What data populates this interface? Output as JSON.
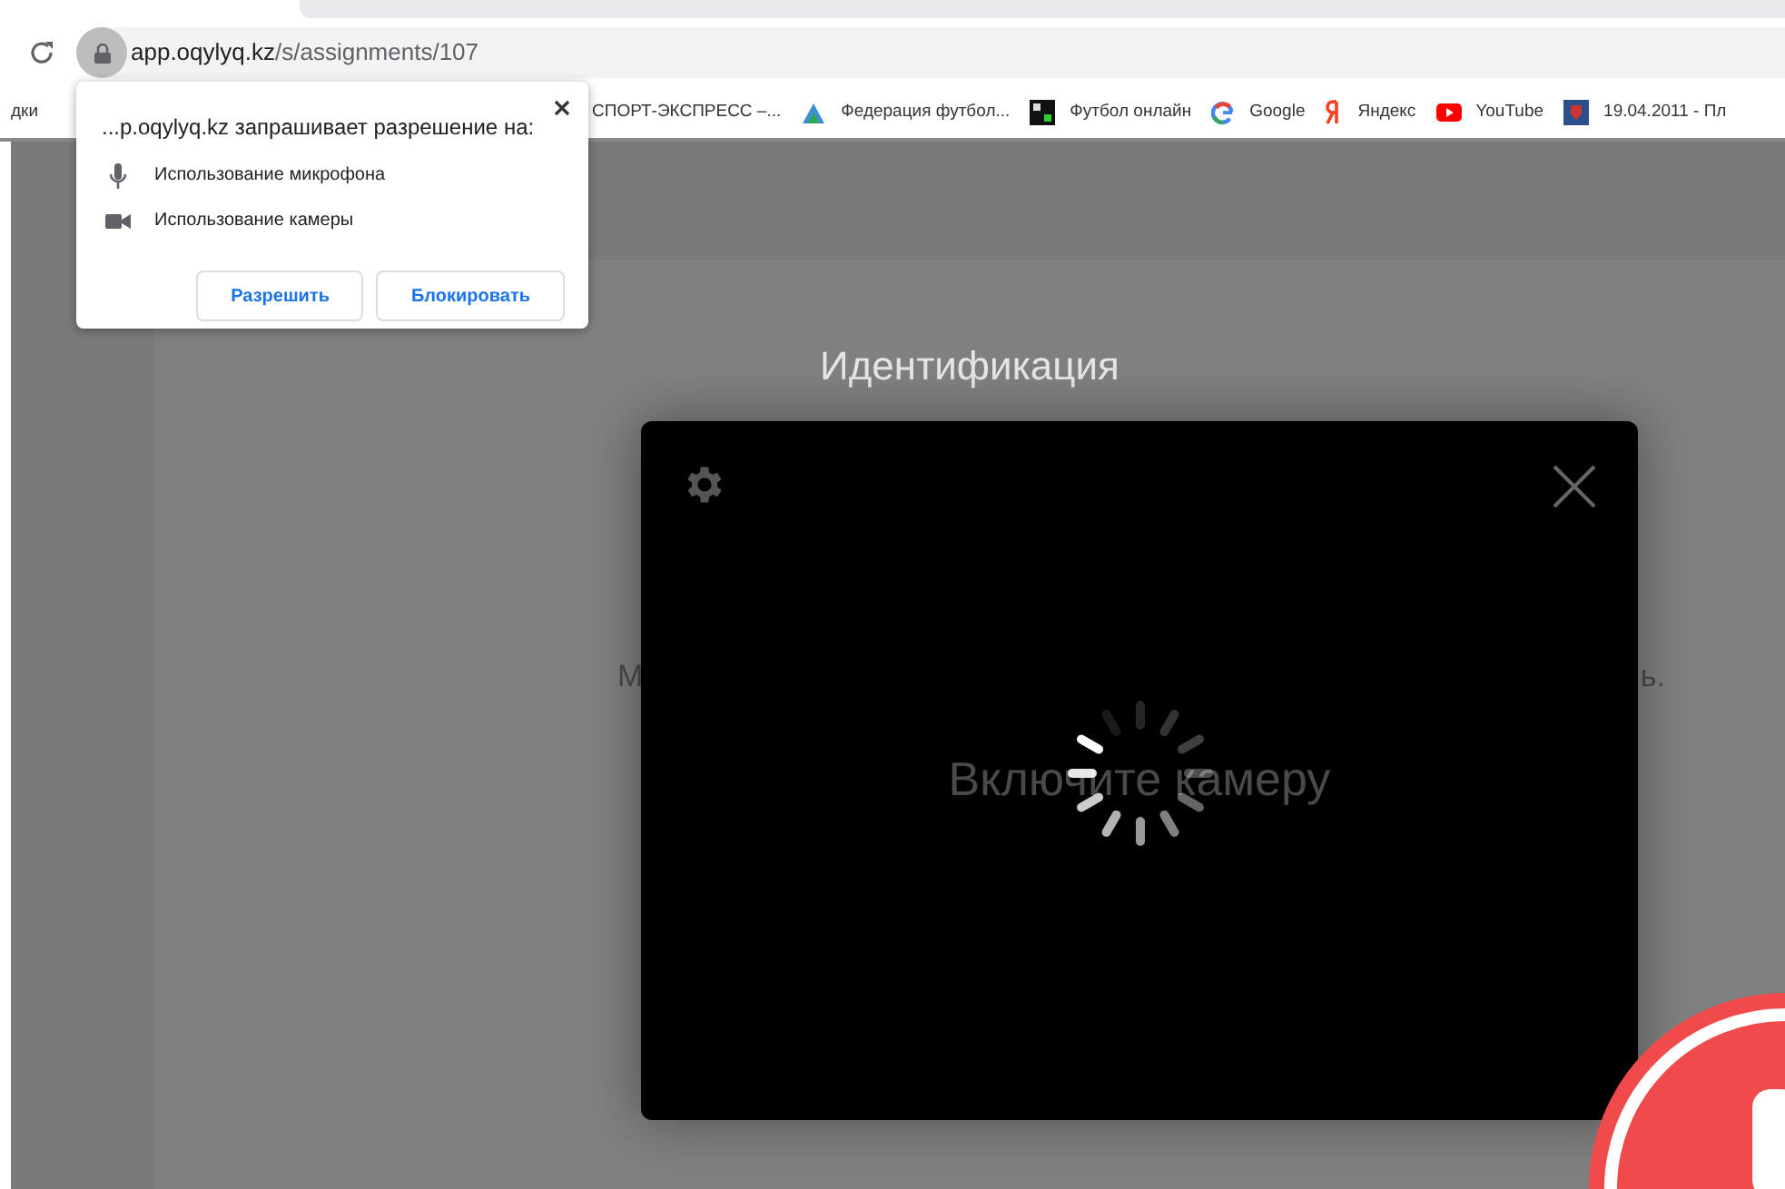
{
  "browser": {
    "url_host": "app.oqylyq.kz",
    "url_path": "/s/assignments/107"
  },
  "bookmarks": [
    {
      "label": "дки",
      "kind": "plain"
    },
    {
      "label": "СПОРТ-ЭКСПРЕСС –...",
      "kind": "plain"
    },
    {
      "label": "Федерация футбол...",
      "kind": "mountain"
    },
    {
      "label": "Футбол онлайн",
      "kind": "tile"
    },
    {
      "label": "Google",
      "kind": "google"
    },
    {
      "label": "Яндекс",
      "kind": "yandex"
    },
    {
      "label": "YouTube",
      "kind": "youtube"
    },
    {
      "label": "19.04.2011 - Пл",
      "kind": "crest"
    }
  ],
  "permission_popup": {
    "title": "...p.oqylyq.kz запрашивает разрешение на:",
    "items": [
      {
        "label": "Использование микрофона",
        "kind": "mic"
      },
      {
        "label": "Использование камеры",
        "kind": "camera"
      }
    ],
    "buttons": [
      "Разрешить",
      "Блокировать"
    ]
  },
  "page": {
    "heading": "Идентификация",
    "text_left": "М",
    "text_right": "ь."
  },
  "camera_modal": {
    "message": "Включите камеру"
  }
}
